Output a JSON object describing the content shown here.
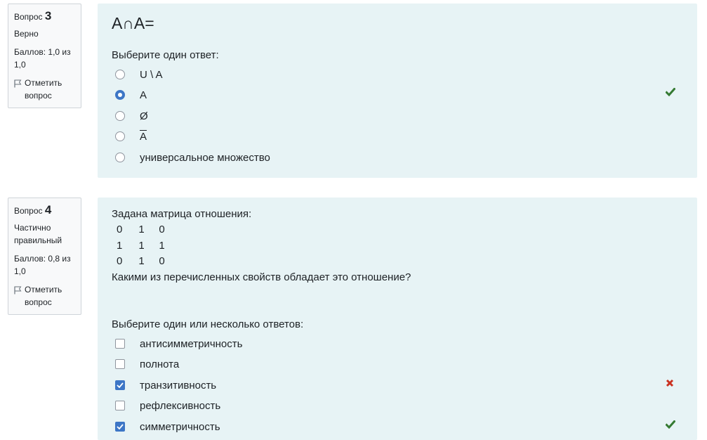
{
  "question3": {
    "label": "Вопрос",
    "number": "3",
    "state": "Верно",
    "grade": "Баллов: 1,0 из 1,0",
    "flag_label": "Отметить вопрос",
    "title": "A∩A=",
    "prompt": "Выберите один ответ:",
    "options": [
      {
        "label": "U \\ A",
        "selected": false
      },
      {
        "label": "A",
        "selected": true,
        "feedback": "correct"
      },
      {
        "label": "Ø",
        "selected": false
      },
      {
        "label": "A",
        "selected": false
      },
      {
        "label": "универсальное множество",
        "selected": false
      }
    ]
  },
  "question4": {
    "label": "Вопрос",
    "number": "4",
    "state": "Частично правильный",
    "grade": "Баллов: 0,8 из 1,0",
    "flag_label": "Отметить вопрос",
    "intro": "Задана матрица отношения:",
    "matrix": [
      [
        "0",
        "1",
        "0"
      ],
      [
        "1",
        "1",
        "1"
      ],
      [
        "0",
        "1",
        "0"
      ]
    ],
    "question": "Какими из перечисленных свойств обладает это отношение?",
    "prompt": "Выберите один или несколько ответов:",
    "options": [
      {
        "label": "антисимметричность",
        "checked": false
      },
      {
        "label": "полнота",
        "checked": false
      },
      {
        "label": "транзитивность",
        "checked": true,
        "feedback": "incorrect"
      },
      {
        "label": "рефлексивность",
        "checked": false
      },
      {
        "label": "симметричность",
        "checked": true,
        "feedback": "correct"
      }
    ]
  },
  "colors": {
    "panel_bg": "#e7f3f5",
    "accent": "#3d76c6",
    "correct": "#357a32",
    "incorrect": "#ca3120"
  },
  "icons": [
    "flag-icon",
    "check-icon",
    "cross-icon"
  ]
}
